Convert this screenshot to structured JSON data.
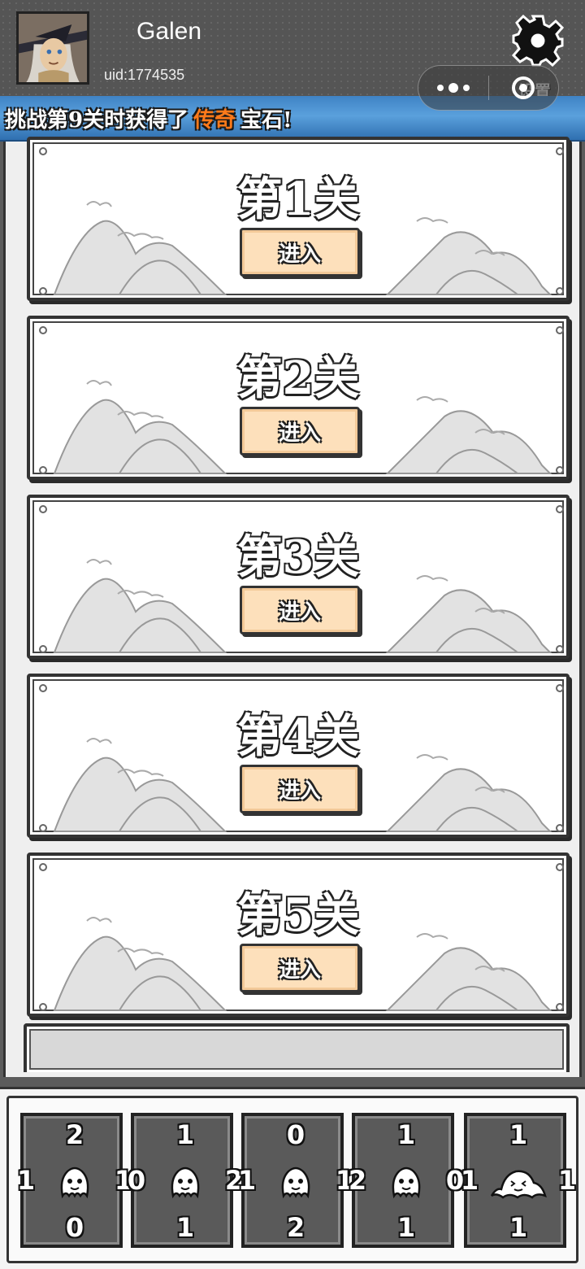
{
  "header": {
    "username": "Galen",
    "uid": "uid:1774535",
    "settings_label": "设置",
    "settings_icon": "gear-icon",
    "capsule_more_icon": "more-dots-icon",
    "capsule_close_icon": "close-circle-icon"
  },
  "banner": {
    "text_before": "挑战第9关时获得了",
    "highlight": "传奇",
    "text_after": "宝石!",
    "highlight_color": "#ff7a1a",
    "background_color": "#4a8fd0"
  },
  "levels": [
    {
      "title": "第1关",
      "button": "进入"
    },
    {
      "title": "第2关",
      "button": "进入"
    },
    {
      "title": "第3关",
      "button": "进入"
    },
    {
      "title": "第4关",
      "button": "进入"
    },
    {
      "title": "第5关",
      "button": "进入"
    }
  ],
  "dock": {
    "tiles": [
      {
        "top": "2",
        "left": "1",
        "right": "1",
        "bottom": "0",
        "icon": "ghost-icon"
      },
      {
        "top": "1",
        "left": "0",
        "right": "2",
        "bottom": "1",
        "icon": "ghost-icon"
      },
      {
        "top": "0",
        "left": "1",
        "right": "1",
        "bottom": "2",
        "icon": "ghost-icon"
      },
      {
        "top": "1",
        "left": "2",
        "right": "0",
        "bottom": "1",
        "icon": "ghost-icon"
      },
      {
        "top": "1",
        "left": "1",
        "right": "1",
        "bottom": "1",
        "icon": "slime-icon"
      }
    ]
  },
  "colors": {
    "button_fill": "#fde0bb",
    "tile_fill": "#5a5a5a",
    "header_bg": "#555555"
  }
}
